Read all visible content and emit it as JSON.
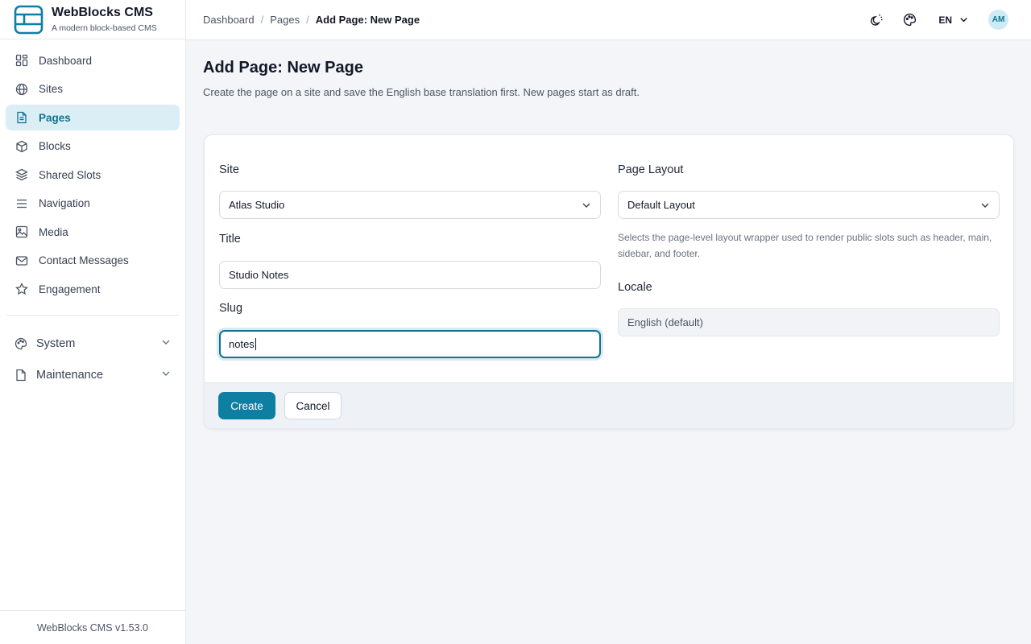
{
  "app": {
    "name": "WebBlocks CMS",
    "tagline": "A modern block-based CMS",
    "version": "WebBlocks CMS v1.53.0"
  },
  "sidebar": {
    "items": [
      {
        "label": "Dashboard",
        "icon": "dashboard-icon",
        "active": false
      },
      {
        "label": "Sites",
        "icon": "globe-icon",
        "active": false
      },
      {
        "label": "Pages",
        "icon": "file-text-icon",
        "active": true
      },
      {
        "label": "Blocks",
        "icon": "cube-icon",
        "active": false
      },
      {
        "label": "Shared Slots",
        "icon": "layers-icon",
        "active": false
      },
      {
        "label": "Navigation",
        "icon": "menu-icon",
        "active": false
      },
      {
        "label": "Media",
        "icon": "image-icon",
        "active": false
      },
      {
        "label": "Contact Messages",
        "icon": "mail-icon",
        "active": false
      },
      {
        "label": "Engagement",
        "icon": "star-icon",
        "active": false
      }
    ],
    "groups": [
      {
        "label": "System",
        "icon": "palette-icon"
      },
      {
        "label": "Maintenance",
        "icon": "file-icon"
      }
    ]
  },
  "topbar": {
    "breadcrumbs": [
      "Dashboard",
      "Pages",
      "Add Page: New Page"
    ],
    "language": "EN",
    "avatar_initials": "AM"
  },
  "page": {
    "title": "Add Page: New Page",
    "description": "Create the page on a site and save the English base translation first. New pages start as draft."
  },
  "form": {
    "site": {
      "label": "Site",
      "value": "Atlas Studio"
    },
    "title": {
      "label": "Title",
      "value": "Studio Notes"
    },
    "slug": {
      "label": "Slug",
      "value": "notes"
    },
    "layout": {
      "label": "Page Layout",
      "value": "Default Layout",
      "help": "Selects the page-level layout wrapper used to render public slots such as header, main, sidebar, and footer."
    },
    "locale": {
      "label": "Locale",
      "value": "English (default)"
    },
    "create_label": "Create",
    "cancel_label": "Cancel"
  },
  "colors": {
    "accent": "#0e7fa3",
    "active_nav_bg": "#dbeef5",
    "page_bg": "#f3f5f9"
  }
}
